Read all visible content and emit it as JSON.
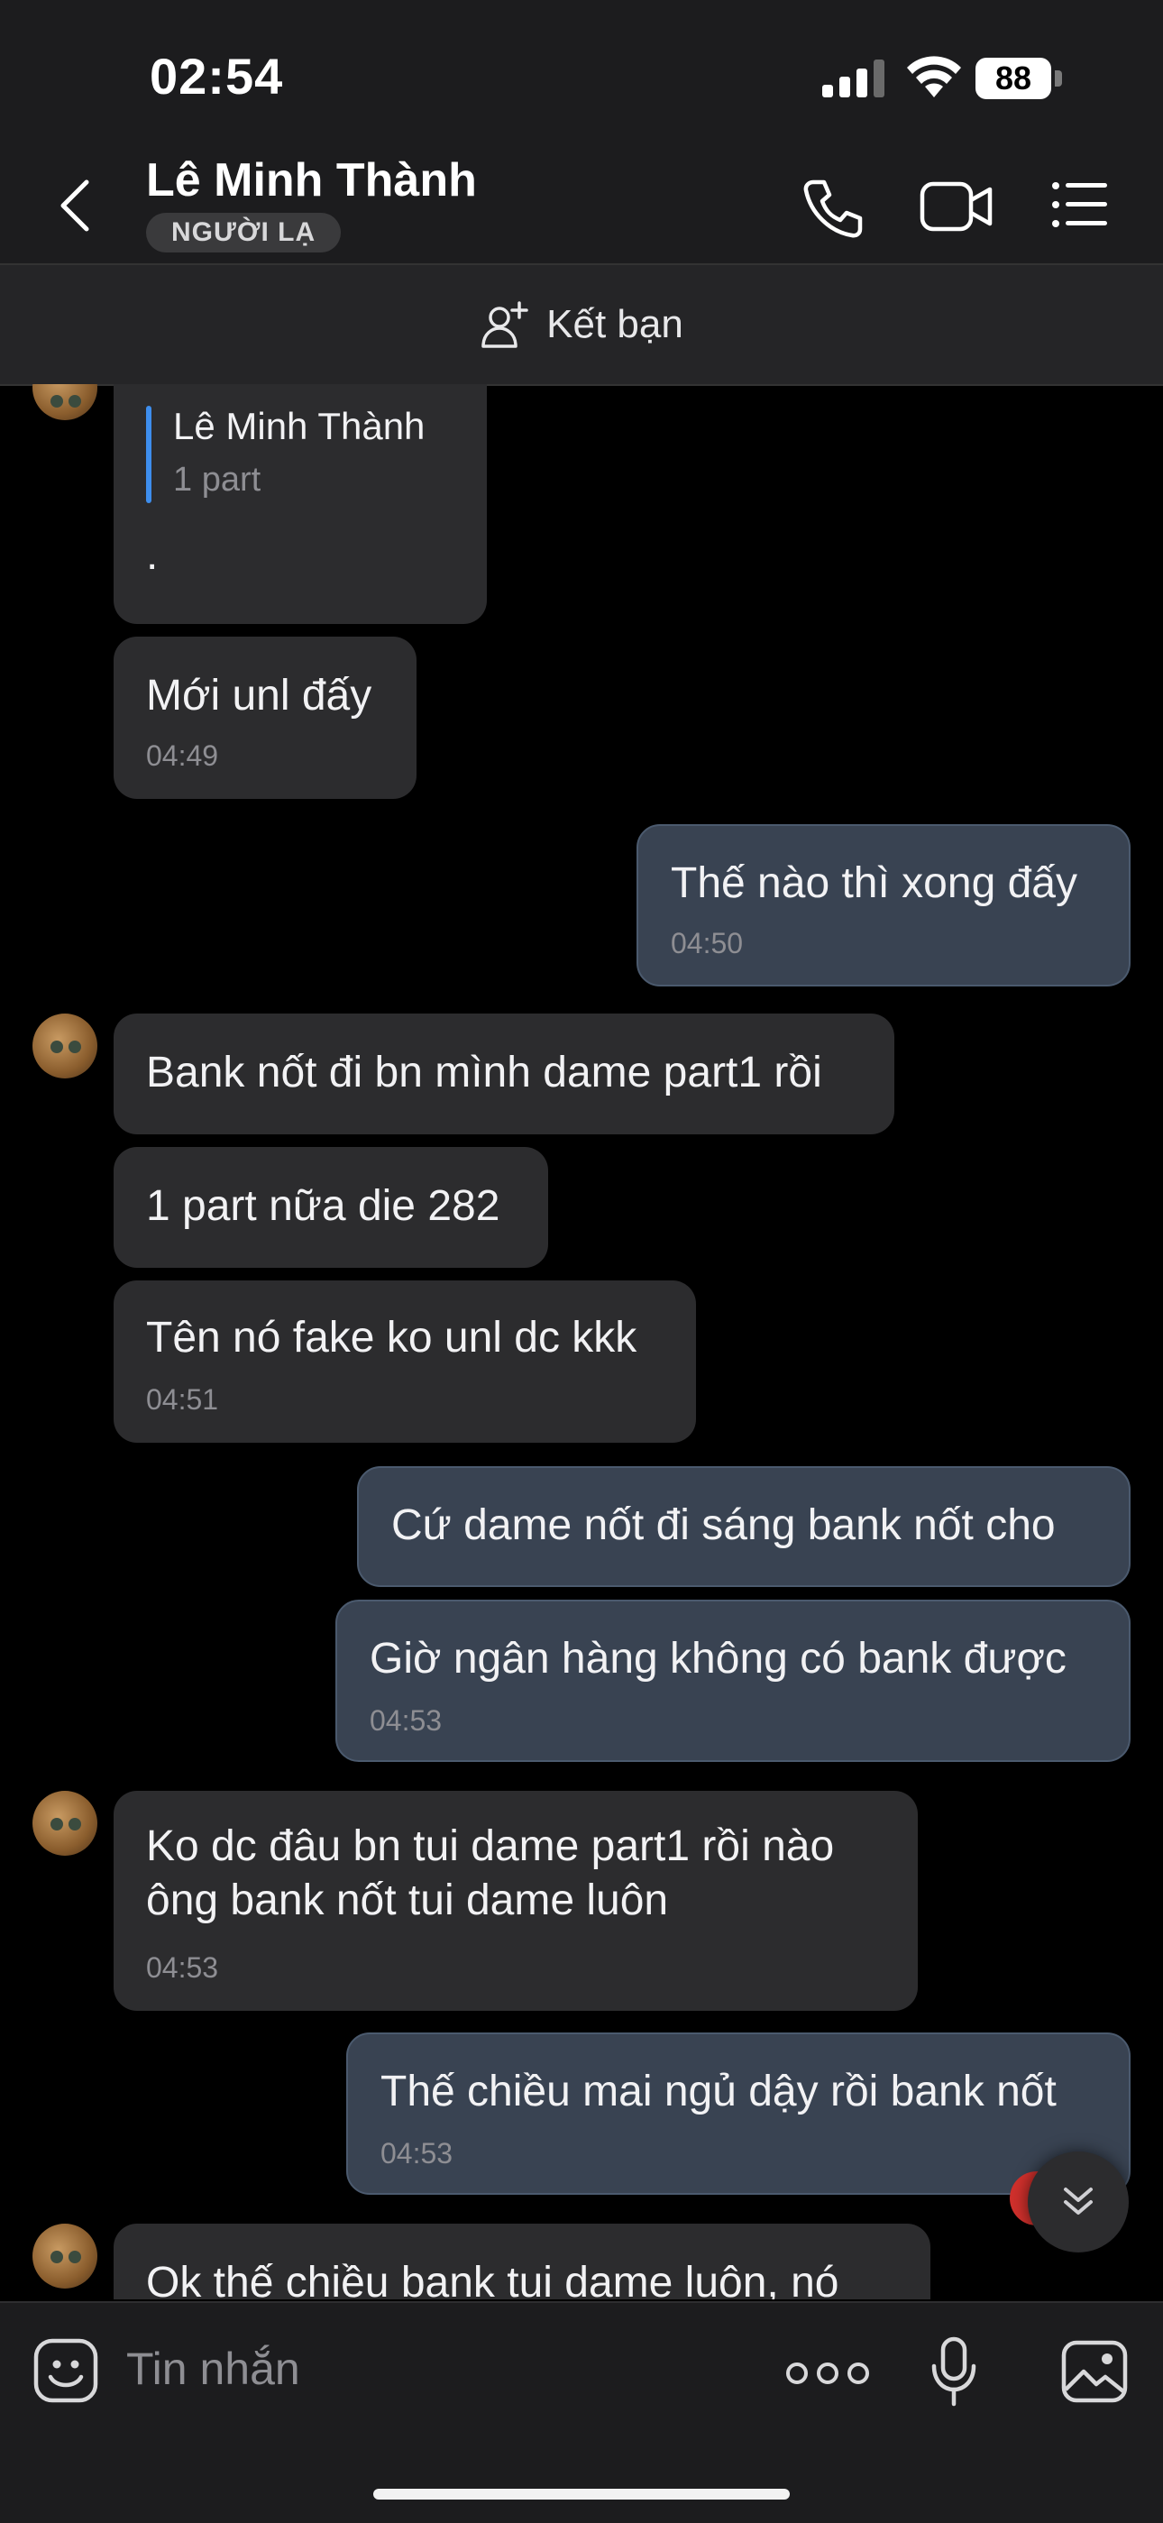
{
  "status_bar": {
    "time": "02:54",
    "battery": "88"
  },
  "header": {
    "contact_name": "Lê Minh Thành",
    "badge": "NGƯỜI LẠ",
    "icons": [
      "back-icon",
      "phone-icon",
      "video-icon",
      "list-menu-icon"
    ]
  },
  "friend_bar": {
    "label": "Kết bạn",
    "icon": "add-friend-icon"
  },
  "messages": [
    {
      "side": "in",
      "quote_name": "Lê Minh Thành",
      "quote_text": "1 part",
      "text": "."
    },
    {
      "side": "in",
      "text": "Mới unl đấy",
      "time": "04:49"
    },
    {
      "side": "out",
      "text": "Thế nào thì xong đấy",
      "time": "04:50"
    },
    {
      "side": "in",
      "text": "Bank nốt đi bn mình dame part1 rồi"
    },
    {
      "side": "in",
      "text": "1 part nữa die 282"
    },
    {
      "side": "in",
      "text": "Tên nó fake ko unl dc kkk",
      "time": "04:51"
    },
    {
      "side": "out",
      "text": "Cứ dame nốt đi sáng bank nốt cho"
    },
    {
      "side": "out",
      "text": "Giờ ngân hàng không có bank được",
      "time": "04:53"
    },
    {
      "side": "in",
      "line1": "Ko dc đâu bn tui dame part1 rồi nào",
      "line2": "ông bank nốt tui dame luôn",
      "time": "04:53"
    },
    {
      "side": "out",
      "text": "Thế chiều mai ngủ dậy rồi bank nốt",
      "time": "04:53"
    },
    {
      "side": "in",
      "text": "Ok thế chiều bank tui dame luôn, nó"
    }
  ],
  "composer": {
    "placeholder": "Tin nhắn",
    "icons": [
      "emoji-icon",
      "more-icon",
      "microphone-icon",
      "image-icon"
    ]
  },
  "colors": {
    "incoming_bubble": "#2c2c2e",
    "outgoing_bubble": "#394352",
    "quote_accent": "#3e8eed",
    "background": "#000000"
  }
}
